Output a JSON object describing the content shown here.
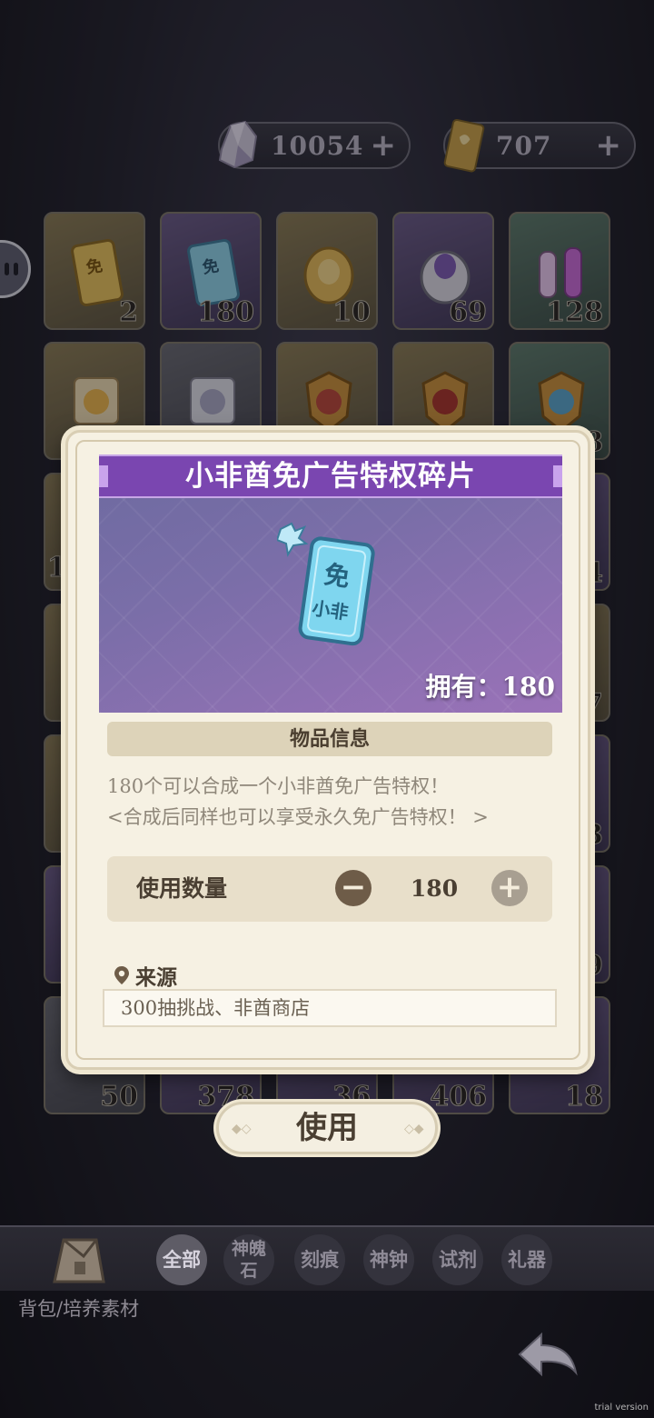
{
  "currency": {
    "crystal_value": "10054",
    "ticket_value": "707",
    "add_symbol": "+"
  },
  "inventory": {
    "row1_counts": [
      "2",
      "180",
      "10",
      "69",
      "128"
    ],
    "row2_counts": [
      "",
      "",
      "",
      "",
      "8"
    ],
    "bottom_counts": [
      "50",
      "378",
      "36",
      "406",
      "18"
    ],
    "right_edge_digits": [
      "4",
      "7",
      "3",
      "9"
    ],
    "left_edge_digits": [
      "1"
    ]
  },
  "item_modal": {
    "title": "小非酋免广告特权碎片",
    "owned_label": "拥有：180",
    "ticket_top_text": "免",
    "ticket_bottom_text": "小非",
    "section_title": "物品信息",
    "description_line1": "180个可以合成一个小非酋免广告特权！",
    "description_line2": "<合成后同样也可以享受永久免广告特权！ >",
    "quantity_label": "使用数量",
    "quantity_value": "180",
    "minus_symbol": "−",
    "plus_symbol": "+",
    "source_label": "来源",
    "source_text": "300抽挑战、非酋商店"
  },
  "use_button_label": "使用",
  "tabs": {
    "all": "全部",
    "soul_stone_line1": "神魄",
    "soul_stone_line2": "石",
    "engrave": "刻痕",
    "bell": "神钟",
    "reagent": "试剂",
    "ritual": "礼器"
  },
  "breadcrumb": "背包/培养素材",
  "watermark": "trial version",
  "colors": {
    "modal_bg": "#f6f1e3",
    "banner_purple": "#7a46b0",
    "accent_brown": "#6e5c48"
  }
}
